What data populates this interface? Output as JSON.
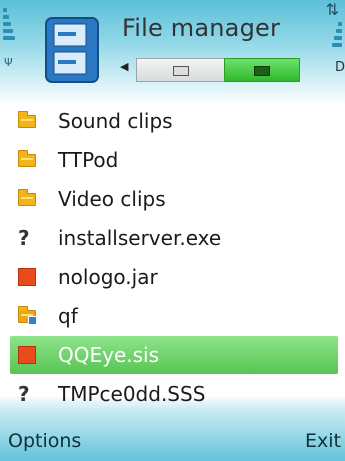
{
  "header": {
    "title": "File manager"
  },
  "tabs": [
    {
      "state": "inactive"
    },
    {
      "state": "active"
    }
  ],
  "files": [
    {
      "name": "Sound clips",
      "icon": "folder-icon"
    },
    {
      "name": "TTPod",
      "icon": "folder-icon"
    },
    {
      "name": "Video clips",
      "icon": "folder-icon"
    },
    {
      "name": "installserver.exe",
      "icon": "unknown-file-icon"
    },
    {
      "name": "nologo.jar",
      "icon": "jar-file-icon"
    },
    {
      "name": "qf",
      "icon": "special-folder-icon"
    },
    {
      "name": "QQEye.sis",
      "icon": "sis-file-icon",
      "selected": true
    },
    {
      "name": "TMPce0dd.SSS",
      "icon": "unknown-file-icon"
    }
  ],
  "unknown_glyph": "?",
  "softkeys": {
    "left": "Options",
    "right": "Exit"
  },
  "colors": {
    "selection": "#57c553",
    "active_tab": "#2fb82c",
    "folder": "#f3b419",
    "jar": "#e84b1c"
  }
}
